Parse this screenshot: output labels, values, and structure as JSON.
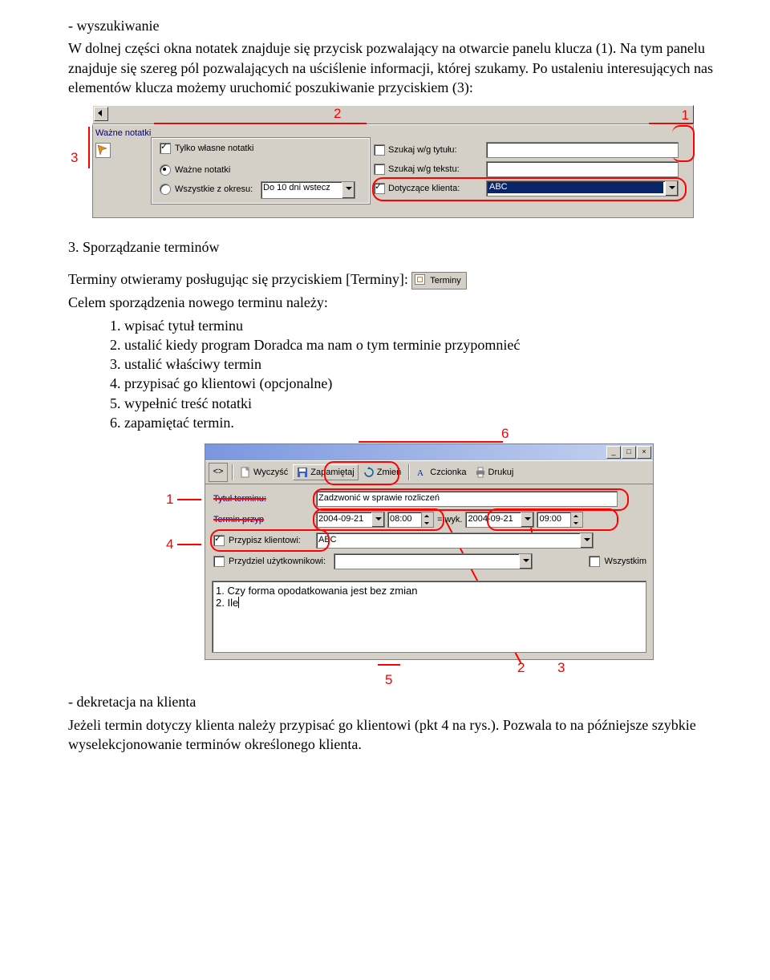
{
  "sec1": {
    "heading": "- wyszukiwanie",
    "para": "W dolnej części okna notatek znajduje się przycisk pozwalający na otwarcie panelu klucza (1). Na tym panelu znajduje się szereg pól pozwalających na uściślenie informacji, której szukamy. Po ustaleniu interesujących nas elementów klucza możemy uruchomić poszukiwanie przyciskiem (3):"
  },
  "shot1": {
    "section": "Ważne notatki",
    "ownOnly": "Tylko własne notatki",
    "radioImportant": "Ważne notatki",
    "radioAll": "Wszystkie z okresu:",
    "period": "Do 10 dni wstecz",
    "byTitle": "Szukaj w/g tytułu:",
    "byText": "Szukaj w/g tekstu:",
    "byClient": "Dotyczące klienta:",
    "clientValue": "ABC",
    "n1": "1",
    "n2": "2",
    "n3": "3"
  },
  "sec2": {
    "heading": "3. Sporządzanie terminów",
    "line1a": "Terminy otwieramy posługując się przyciskiem [Terminy]: ",
    "btn": "Terminy",
    "line2": "Celem sporządzenia nowego terminu należy:",
    "li1": "wpisać tytuł terminu",
    "li2": "ustalić kiedy program Doradca ma nam o tym terminie przypomnieć",
    "li3": "ustalić właściwy termin",
    "li4": "przypisać go klientowi (opcjonalne)",
    "li5": "wypełnić treść notatki",
    "li6": "zapamiętać termin."
  },
  "shot2": {
    "tbClear": "Wyczyść",
    "tbSave": "Zapamiętaj",
    "tbChange": "Zmień",
    "tbFont": "Czcionka",
    "tbPrint": "Drukuj",
    "lblTitle": "Tytuł terminu:",
    "valTitle": "Zadzwonić w sprawie rozliczeń",
    "lblRemind": "Termin przyp",
    "date1": "2004-09-21",
    "time1": "08:00",
    "eqWyk": "=  wyk.",
    "date2": "2004-09-21",
    "time2": "09:00",
    "chkClient": "Przypisz klientowi:",
    "valClient": "ABC",
    "chkUser": "Przydziel użytkownikowi:",
    "all": "Wszystkim",
    "memoLine1": "1. Czy forma opodatkowania jest bez zmian",
    "memoLine2": "2. Ile",
    "n1": "1",
    "n2": "2",
    "n3": "3",
    "n4": "4",
    "n5": "5",
    "n6": "6"
  },
  "sec3": {
    "heading": "- dekretacja na klienta",
    "para": "Jeżeli termin dotyczy klienta należy przypisać go klientowi (pkt 4 na rys.). Pozwala to na późniejsze szybkie wyselekcjonowanie terminów określonego klienta."
  }
}
